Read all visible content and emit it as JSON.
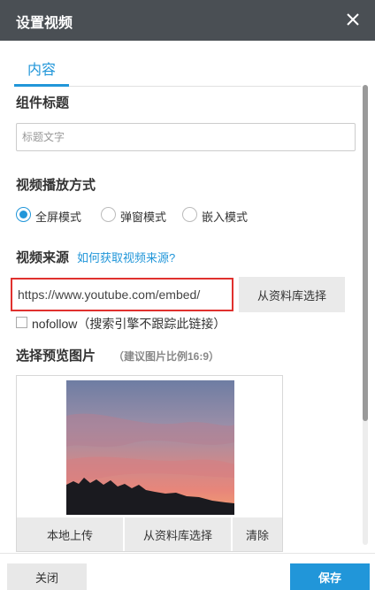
{
  "dialog": {
    "title": "设置视频",
    "close_icon": "close-icon"
  },
  "tabs": [
    {
      "label": "内容",
      "active": true
    }
  ],
  "component_title": {
    "label": "组件标题",
    "placeholder": "标题文字",
    "value": ""
  },
  "playback": {
    "label": "视频播放方式",
    "options": [
      {
        "label": "全屏模式",
        "selected": true
      },
      {
        "label": "弹窗模式",
        "selected": false
      },
      {
        "label": "嵌入模式",
        "selected": false
      }
    ]
  },
  "source": {
    "label": "视频来源",
    "help_link": "如何获取视频来源?",
    "url_value": "https://www.youtube.com/embed/",
    "library_button": "从资料库选择",
    "nofollow_checked": false,
    "nofollow_label": "nofollow（搜索引擎不跟踪此链接）"
  },
  "preview": {
    "label": "选择预览图片",
    "hint": "（建议图片比例16:9）",
    "buttons": {
      "local_upload": "本地上传",
      "from_library": "从资料库选择",
      "clear": "清除"
    }
  },
  "footer": {
    "close": "关闭",
    "save": "保存"
  },
  "colors": {
    "header_bg": "#4a4f54",
    "accent": "#2196d9",
    "highlight_border": "#e0312e"
  }
}
